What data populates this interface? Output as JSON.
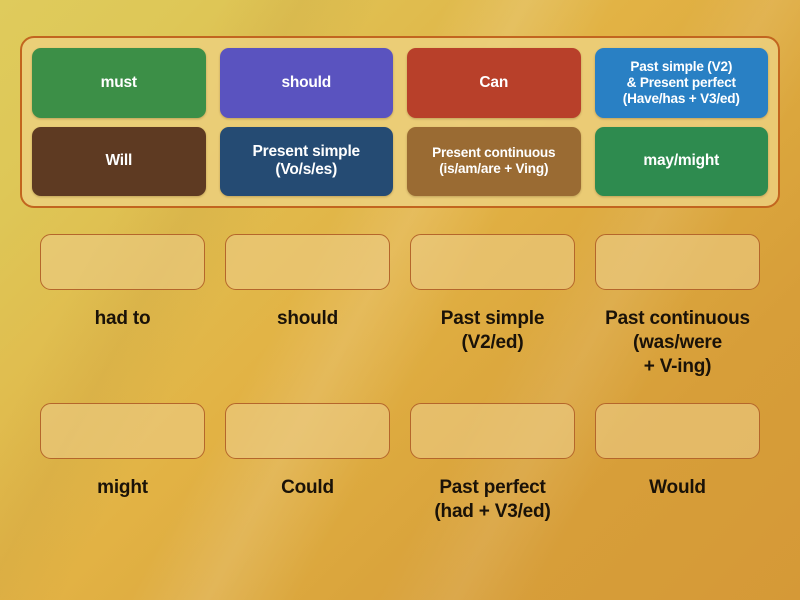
{
  "background": {
    "gradient_from": "#DFCB5C",
    "gradient_to": "#D59937"
  },
  "tray": {
    "panel_fill": "#ECD07E",
    "panel_border": "#C2651F",
    "tiles": [
      {
        "label": "must",
        "color": "#3C8F47",
        "text_color": "#FFFFFF",
        "size": "normal"
      },
      {
        "label": "should",
        "color": "#5A53BF",
        "text_color": "#FFFFFF",
        "size": "normal"
      },
      {
        "label": "Can",
        "color": "#B8402A",
        "text_color": "#FFFFFF",
        "size": "normal"
      },
      {
        "label": "Past simple (V2)\n& Present perfect\n(Have/has + V3/ed)",
        "color": "#2980C4",
        "text_color": "#FFFFFF",
        "size": "small"
      },
      {
        "label": "Will",
        "color": "#5E3A22",
        "text_color": "#FFFFFF",
        "size": "normal"
      },
      {
        "label": "Present simple\n(Vo/s/es)",
        "color": "#254B73",
        "text_color": "#FFFFFF",
        "size": "normal"
      },
      {
        "label": "Present continuous\n(is/am/are + Ving)",
        "color": "#9A6B33",
        "text_color": "#FFFFFF",
        "size": "small"
      },
      {
        "label": "may/might",
        "color": "#2E8B4F",
        "text_color": "#FFFFFF",
        "size": "normal"
      }
    ]
  },
  "answers": {
    "dropzone_fill": "#E6C477",
    "dropzone_border": "#B5662B",
    "label_color": "#1A1208",
    "cells": [
      {
        "dropzone_value": "",
        "label": "had to"
      },
      {
        "dropzone_value": "",
        "label": "should"
      },
      {
        "dropzone_value": "",
        "label": "Past simple\n(V2/ed)"
      },
      {
        "dropzone_value": "",
        "label": "Past continuous\n(was/were\n+ V-ing)"
      },
      {
        "dropzone_value": "",
        "label": "might"
      },
      {
        "dropzone_value": "",
        "label": "Could"
      },
      {
        "dropzone_value": "",
        "label": "Past perfect\n(had + V3/ed)"
      },
      {
        "dropzone_value": "",
        "label": "Would"
      }
    ]
  }
}
